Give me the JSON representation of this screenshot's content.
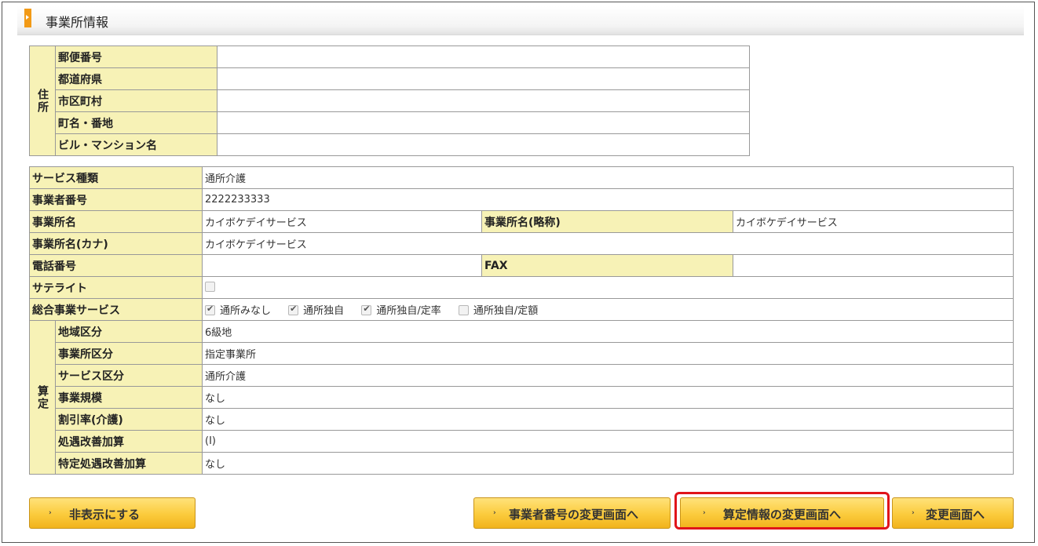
{
  "section": {
    "title": "事業所情報"
  },
  "address": {
    "group_label": "住所",
    "rows": [
      {
        "label": "郵便番号",
        "value": ""
      },
      {
        "label": "都道府県",
        "value": ""
      },
      {
        "label": "市区町村",
        "value": ""
      },
      {
        "label": "町名・番地",
        "value": ""
      },
      {
        "label": "ビル・マンション名",
        "value": ""
      }
    ]
  },
  "info": {
    "service_type_label": "サービス種類",
    "service_type_value": "通所介護",
    "jigyousha_no_label": "事業者番号",
    "jigyousha_no_value": "2222233333",
    "office_name_label": "事業所名",
    "office_name_value": "カイボケデイサービス",
    "office_short_label": "事業所名(略称)",
    "office_short_value": "カイボケデイサービス",
    "office_kana_label": "事業所名(カナ)",
    "office_kana_value": "カイボケデイサービス",
    "phone_label": "電話番号",
    "phone_value": "",
    "fax_label": "FAX",
    "fax_value": "",
    "satellite_label": "サテライト",
    "satellite_checked": false,
    "sogo_label": "総合事業サービス",
    "sogo_options": [
      {
        "label": "通所みなし",
        "checked": true
      },
      {
        "label": "通所独自",
        "checked": true
      },
      {
        "label": "通所独自/定率",
        "checked": true
      },
      {
        "label": "通所独自/定額",
        "checked": false
      }
    ]
  },
  "santei": {
    "group_label": "算定",
    "rows": [
      {
        "label": "地域区分",
        "value": "6級地"
      },
      {
        "label": "事業所区分",
        "value": "指定事業所"
      },
      {
        "label": "サービス区分",
        "value": "通所介護"
      },
      {
        "label": "事業規模",
        "value": "なし"
      },
      {
        "label": "割引率(介護)",
        "value": "なし"
      },
      {
        "label": "処遇改善加算",
        "value": "(Ⅰ)"
      },
      {
        "label": "特定処遇改善加算",
        "value": "なし"
      }
    ]
  },
  "buttons": {
    "hide": "非表示にする",
    "jigyousha_change": "事業者番号の変更画面へ",
    "santei_change": "算定情報の変更画面へ",
    "change": "変更画面へ"
  },
  "colors": {
    "label_bg": "#f7f2b6",
    "button": "#fbcb3c",
    "highlight": "#e0141a",
    "section_marker": "#f29a16"
  },
  "icons": {
    "button_arrow": "›"
  }
}
